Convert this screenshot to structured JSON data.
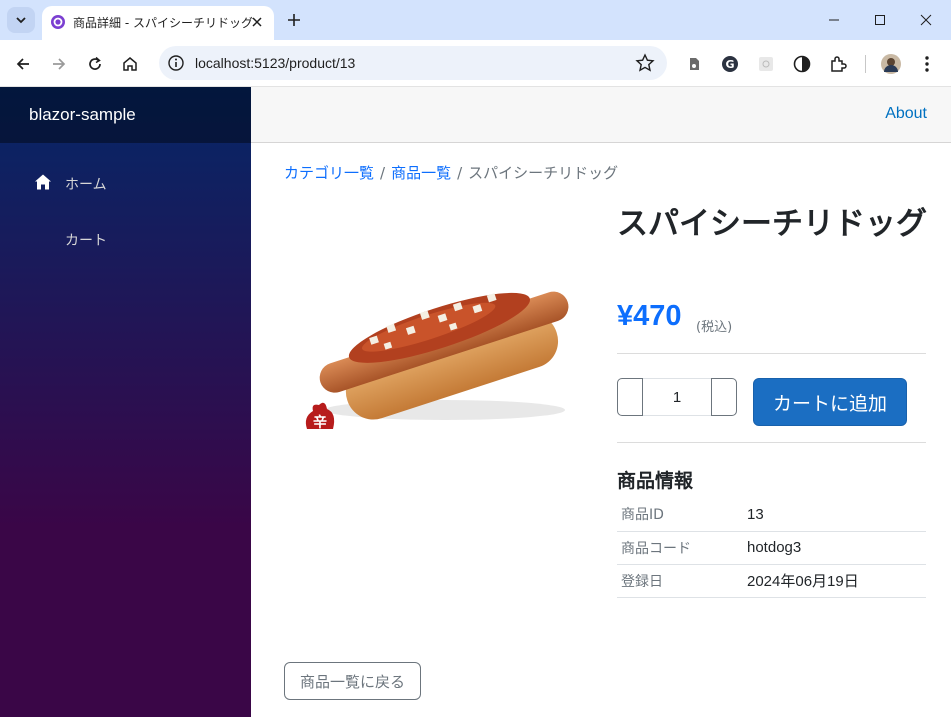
{
  "browser": {
    "tab_title": "商品詳細 - スパイシーチリドッグ",
    "url": "localhost:5123/product/13"
  },
  "app": {
    "brand": "blazor-sample",
    "nav": [
      {
        "label": "ホーム",
        "icon": "home-icon"
      },
      {
        "label": "カート",
        "icon": ""
      }
    ],
    "about_link": "About"
  },
  "breadcrumb": {
    "items": [
      "カテゴリ一覧",
      "商品一覧"
    ],
    "separator": "/",
    "active": "スパイシーチリドッグ"
  },
  "product": {
    "name": "スパイシーチリドッグ",
    "price": "¥470",
    "tax_note": "(税込)",
    "quantity": "1",
    "add_to_cart_label": "カートに追加",
    "spicy_badge": "辛"
  },
  "info": {
    "heading": "商品情報",
    "rows": [
      {
        "key": "商品ID",
        "value": "13"
      },
      {
        "key": "商品コード",
        "value": "hotdog3"
      },
      {
        "key": "登録日",
        "value": "2024年06月19日"
      }
    ]
  },
  "back_button": "商品一覧に戻る",
  "colors": {
    "accent": "#0d6efd",
    "primary_button": "#1b6ec2",
    "sidebar_top": "#052767",
    "sidebar_bottom": "#3a0647"
  }
}
